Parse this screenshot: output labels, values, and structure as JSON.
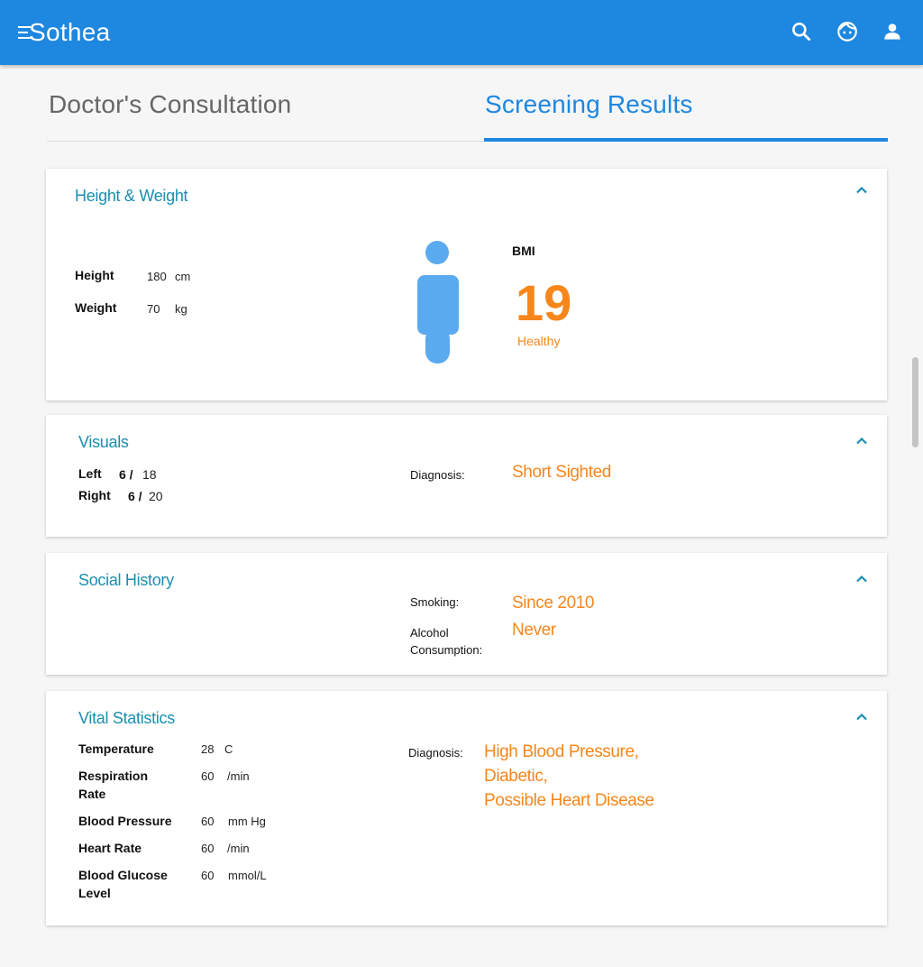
{
  "app": {
    "title": "Sothea"
  },
  "header_icons": [
    "menu-icon",
    "search-icon",
    "face-icon",
    "account-icon"
  ],
  "tabs": [
    {
      "label": "Doctor's Consultation",
      "active": false
    },
    {
      "label": "Screening Results",
      "active": true
    }
  ],
  "height_weight": {
    "title": "Height & Weight",
    "height_label": "Height",
    "height_value": "180",
    "height_unit": "cm",
    "weight_label": "Weight",
    "weight_value": "70",
    "weight_unit": "kg",
    "bmi_label": "BMI",
    "bmi_value": "19",
    "bmi_status": "Healthy"
  },
  "visuals": {
    "title": "Visuals",
    "left_label": "Left",
    "left_num": "6 /",
    "left_den": "18",
    "right_label": "Right",
    "right_num": "6 /",
    "right_den": "20",
    "diagnosis_label": "Diagnosis:",
    "diagnosis_value": "Short Sighted"
  },
  "social_history": {
    "title": "Social History",
    "smoking_label": "Smoking:",
    "smoking_value": "Since 2010",
    "alcohol_label_1": "Alcohol",
    "alcohol_label_2": "Consumption:",
    "alcohol_value": "Never"
  },
  "vitals": {
    "title": "Vital Statistics",
    "rows": [
      {
        "label_1": "Temperature",
        "label_2": "",
        "value": "28",
        "unit": "C"
      },
      {
        "label_1": "Respiration",
        "label_2": "Rate",
        "value": "60",
        "unit": "/min"
      },
      {
        "label_1": "Blood Pressure",
        "label_2": "",
        "value": "60",
        "unit": "mm Hg"
      },
      {
        "label_1": "Heart Rate",
        "label_2": "",
        "value": "60",
        "unit": "/min"
      },
      {
        "label_1": "Blood Glucose",
        "label_2": "Level",
        "value": "60",
        "unit": "mmol/L"
      }
    ],
    "diagnosis_label": "Diagnosis:",
    "diagnosis_lines": [
      "High Blood Pressure,",
      "Diabetic,",
      "Possible Heart Disease"
    ]
  },
  "colors": {
    "primary": "#1e87e0",
    "accent": "#f7861b",
    "title": "#1a8fb0",
    "figure": "#5aaaf0"
  }
}
